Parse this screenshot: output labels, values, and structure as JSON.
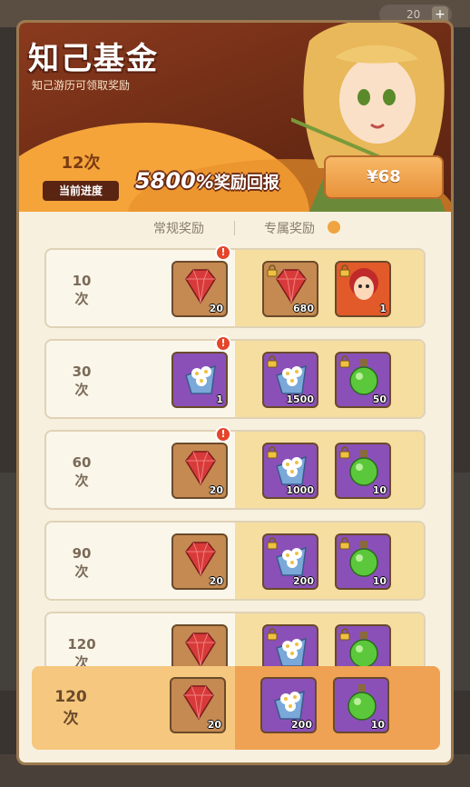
{
  "background": {
    "top_pill_value": "20",
    "top_pill_plus": "+"
  },
  "header": {
    "title": "知己基金",
    "subtitle": "知己游历可领取奖励",
    "progress_count": "12次",
    "progress_label": "当前进度",
    "reward_percent": "5800",
    "reward_percent_sign": "%",
    "reward_text": "奖励回报",
    "price": "¥68"
  },
  "columns": {
    "normal": "常规奖励",
    "exclusive": "专属奖励"
  },
  "rows": [
    {
      "count_num": "10",
      "count_unit": "次",
      "normal_qty": "20",
      "ex1_qty": "680",
      "ex2_qty": "1"
    },
    {
      "count_num": "30",
      "count_unit": "次",
      "normal_qty": "1",
      "ex1_qty": "1500",
      "ex2_qty": "50"
    },
    {
      "count_num": "60",
      "count_unit": "次",
      "normal_qty": "20",
      "ex1_qty": "1000",
      "ex2_qty": "10"
    },
    {
      "count_num": "90",
      "count_unit": "次",
      "normal_qty": "20",
      "ex1_qty": "200",
      "ex2_qty": "10"
    },
    {
      "count_num": "120",
      "count_unit": "次",
      "normal_qty": "20",
      "ex1_qty": "200",
      "ex2_qty": "10"
    }
  ],
  "current_row": {
    "count_num": "120",
    "count_unit": "次",
    "normal_qty": "20",
    "ex1_qty": "200",
    "ex2_qty": "10"
  },
  "alert_mark": "!",
  "colors": {
    "accent_orange": "#f0a440",
    "gem_red": "#d83a3a",
    "item_purple": "#8a50b8",
    "header_brown": "#6a2a14"
  }
}
